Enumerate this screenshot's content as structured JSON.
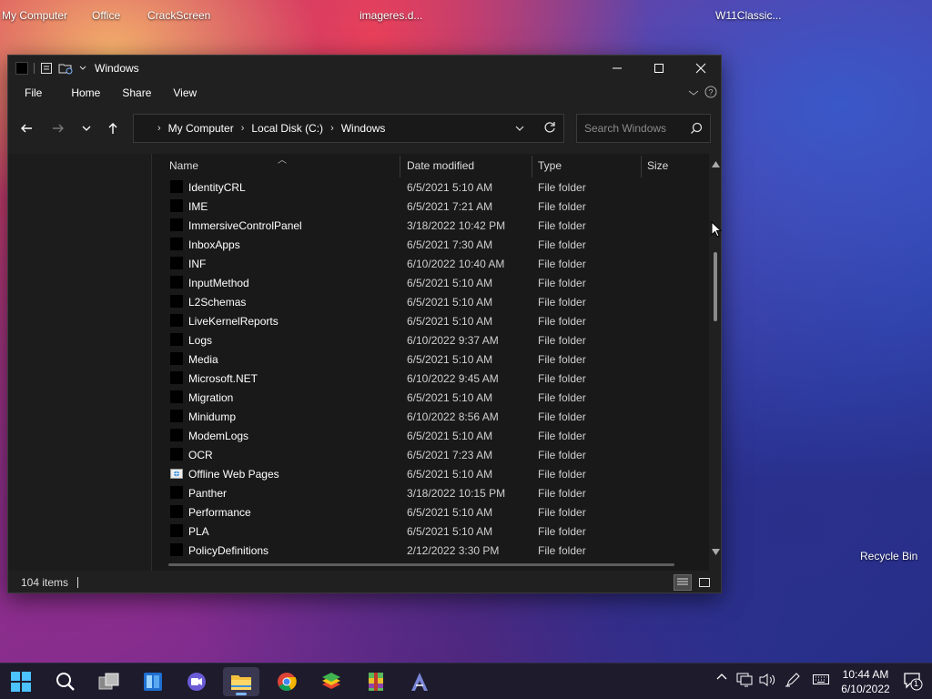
{
  "desktop": {
    "icons": [
      {
        "label": "My Computer"
      },
      {
        "label": "Office"
      },
      {
        "label": "CrackScreen"
      },
      {
        "label": "imageres.d..."
      },
      {
        "label": "W11Classic..."
      },
      {
        "label": "Recycle Bin"
      }
    ]
  },
  "window": {
    "title": "Windows",
    "ribbon_tabs": [
      "File",
      "Home",
      "Share",
      "View"
    ],
    "breadcrumb": [
      "My Computer",
      "Local Disk (C:)",
      "Windows"
    ],
    "search_placeholder": "Search Windows",
    "columns": {
      "name": "Name",
      "date": "Date modified",
      "type": "Type",
      "size": "Size"
    },
    "files": [
      {
        "name": "IdentityCRL",
        "date": "6/5/2021 5:10 AM",
        "type": "File folder",
        "icon": "folder-icon"
      },
      {
        "name": "IME",
        "date": "6/5/2021 7:21 AM",
        "type": "File folder",
        "icon": "folder-icon"
      },
      {
        "name": "ImmersiveControlPanel",
        "date": "3/18/2022 10:42 PM",
        "type": "File folder",
        "icon": "folder-icon"
      },
      {
        "name": "InboxApps",
        "date": "6/5/2021 7:30 AM",
        "type": "File folder",
        "icon": "folder-icon"
      },
      {
        "name": "INF",
        "date": "6/10/2022 10:40 AM",
        "type": "File folder",
        "icon": "folder-icon"
      },
      {
        "name": "InputMethod",
        "date": "6/5/2021 5:10 AM",
        "type": "File folder",
        "icon": "folder-icon"
      },
      {
        "name": "L2Schemas",
        "date": "6/5/2021 5:10 AM",
        "type": "File folder",
        "icon": "folder-icon"
      },
      {
        "name": "LiveKernelReports",
        "date": "6/5/2021 5:10 AM",
        "type": "File folder",
        "icon": "folder-icon"
      },
      {
        "name": "Logs",
        "date": "6/10/2022 9:37 AM",
        "type": "File folder",
        "icon": "folder-icon"
      },
      {
        "name": "Media",
        "date": "6/5/2021 5:10 AM",
        "type": "File folder",
        "icon": "folder-icon"
      },
      {
        "name": "Microsoft.NET",
        "date": "6/10/2022 9:45 AM",
        "type": "File folder",
        "icon": "folder-icon"
      },
      {
        "name": "Migration",
        "date": "6/5/2021 5:10 AM",
        "type": "File folder",
        "icon": "folder-icon"
      },
      {
        "name": "Minidump",
        "date": "6/10/2022 8:56 AM",
        "type": "File folder",
        "icon": "folder-icon"
      },
      {
        "name": "ModemLogs",
        "date": "6/5/2021 5:10 AM",
        "type": "File folder",
        "icon": "folder-icon"
      },
      {
        "name": "OCR",
        "date": "6/5/2021 7:23 AM",
        "type": "File folder",
        "icon": "folder-icon"
      },
      {
        "name": "Offline Web Pages",
        "date": "6/5/2021 5:10 AM",
        "type": "File folder",
        "icon": "web-folder-icon"
      },
      {
        "name": "Panther",
        "date": "3/18/2022 10:15 PM",
        "type": "File folder",
        "icon": "folder-icon"
      },
      {
        "name": "Performance",
        "date": "6/5/2021 5:10 AM",
        "type": "File folder",
        "icon": "folder-icon"
      },
      {
        "name": "PLA",
        "date": "6/5/2021 5:10 AM",
        "type": "File folder",
        "icon": "folder-icon"
      },
      {
        "name": "PolicyDefinitions",
        "date": "2/12/2022 3:30 PM",
        "type": "File folder",
        "icon": "folder-icon"
      }
    ],
    "status": {
      "item_count": "104 items"
    }
  },
  "taskbar": {
    "apps": [
      "start-icon",
      "search-icon",
      "task-view-icon",
      "widgets-icon",
      "teams-chat-icon",
      "file-explorer-icon",
      "chrome-icon",
      "bluestacks-icon",
      "winrar-icon",
      "app-icon"
    ],
    "active_app": "file-explorer-icon",
    "clock": {
      "time": "10:44 AM",
      "date": "6/10/2022"
    },
    "notification_count": "1"
  },
  "colors": {
    "window_bg": "#202020",
    "list_bg": "#191919",
    "taskbar_bg": "#1d1b2c",
    "accent": "#7fb6ff"
  }
}
